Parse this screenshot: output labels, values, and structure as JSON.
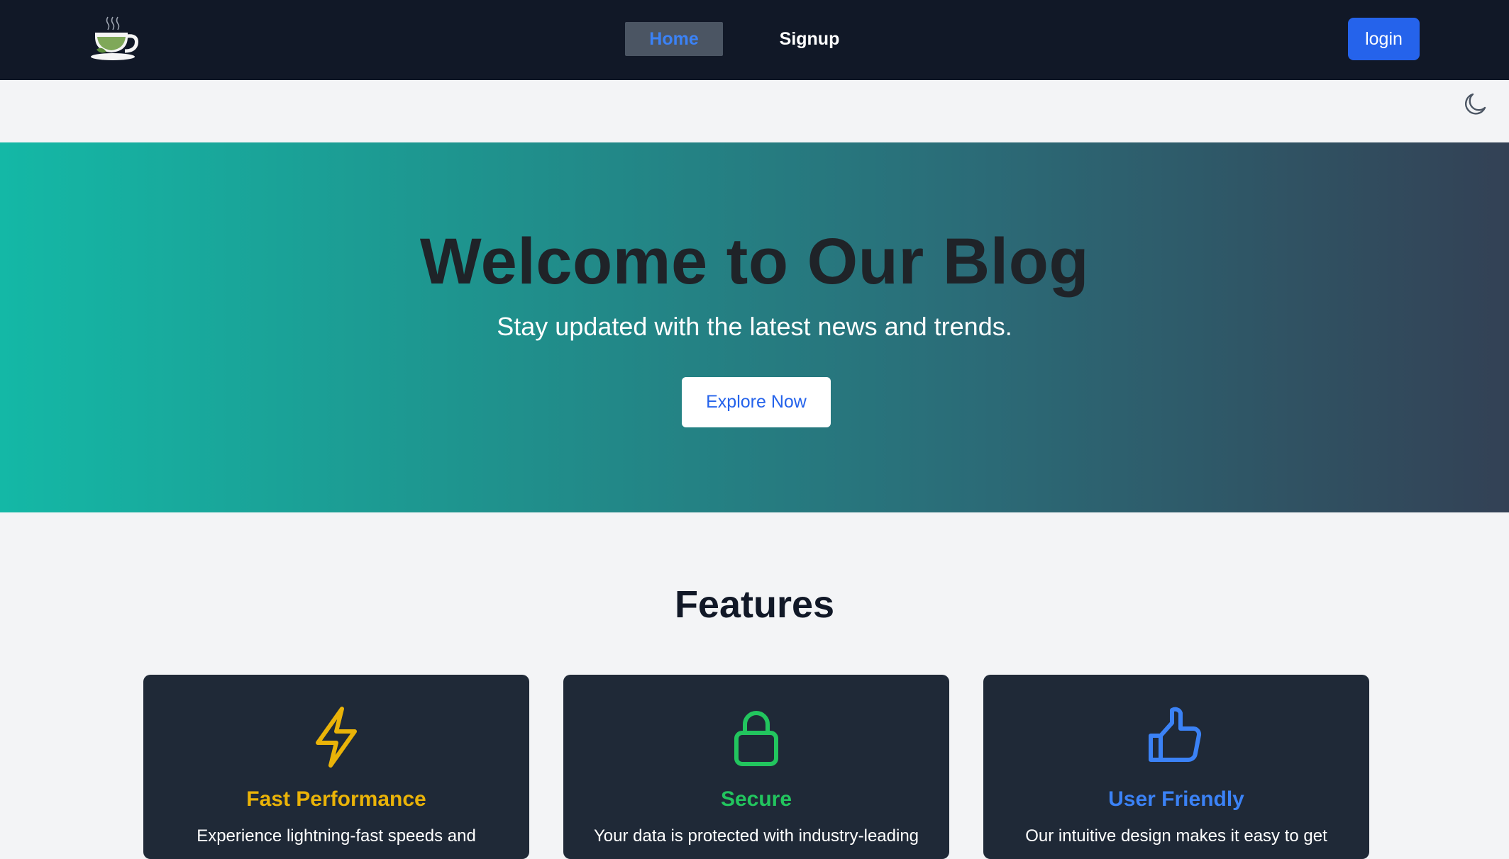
{
  "nav": {
    "home_label": "Home",
    "signup_label": "Signup",
    "login_label": "login",
    "logo_icon": "tea-cup-icon"
  },
  "theme_toggle_icon": "moon-icon",
  "hero": {
    "title": "Welcome to Our Blog",
    "subtitle": "Stay updated with the latest news and trends.",
    "cta_label": "Explore Now"
  },
  "features": {
    "title": "Features",
    "cards": [
      {
        "title": "Fast Performance",
        "text": "Experience lightning-fast speeds and",
        "icon": "lightning-bolt-icon",
        "color": "#eab308"
      },
      {
        "title": "Secure",
        "text": "Your data is protected with industry-leading",
        "icon": "lock-icon",
        "color": "#22c55e"
      },
      {
        "title": "User Friendly",
        "text": "Our intuitive design makes it easy to get",
        "icon": "thumbs-up-icon",
        "color": "#3b82f6"
      }
    ]
  },
  "colors": {
    "nav_bg": "#111827",
    "home_bg": "#4b5563",
    "accent_blue": "#2563eb",
    "card_bg": "#1f2937"
  }
}
